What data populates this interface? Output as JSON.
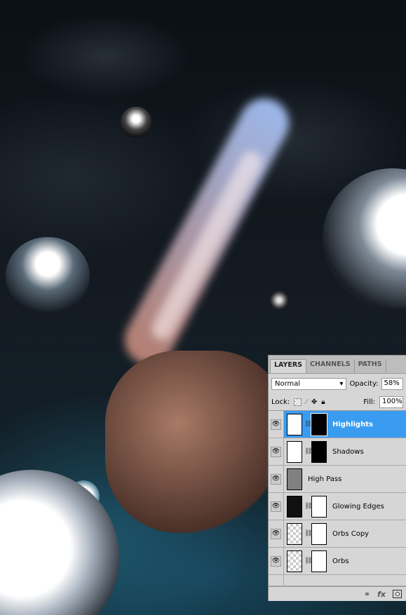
{
  "colors": {
    "selection": "#3a9cf0",
    "panel": "#d6d6d6"
  },
  "panel": {
    "tabs": [
      {
        "label": "LAYERS",
        "active": true
      },
      {
        "label": "CHANNELS"
      },
      {
        "label": "PATHS"
      }
    ],
    "blend_mode": "Normal",
    "opacity_label": "Opacity:",
    "opacity": "58%",
    "lock_label": "Lock:",
    "fill_label": "Fill:",
    "fill": "100%",
    "layers": [
      {
        "name": "Highlights",
        "selected": true,
        "type": "curves-adjustment",
        "mask": true
      },
      {
        "name": "Shadows",
        "type": "curves-adjustment",
        "mask": true
      },
      {
        "name": "High Pass",
        "type": "pixel",
        "mask": false
      },
      {
        "name": "Glowing Edges",
        "type": "pixel",
        "mask": true
      },
      {
        "name": "Orbs Copy",
        "type": "pixel",
        "mask": true
      },
      {
        "name": "Orbs",
        "type": "pixel",
        "mask": true
      }
    ],
    "footer_icons": [
      "link-icon",
      "fx-icon",
      "mask-icon"
    ]
  }
}
